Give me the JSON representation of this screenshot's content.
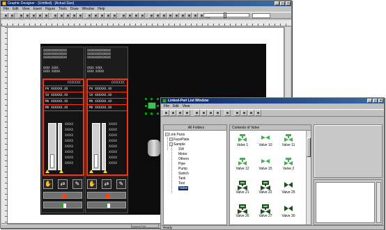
{
  "main_window": {
    "title": "Graphic Designer - [Untitled] - [Actual Size]",
    "menu": [
      "File",
      "Edit",
      "View",
      "Insert",
      "Figure",
      "Tools",
      "Draw",
      "Window",
      "Help"
    ],
    "status_cell": "Linked-Part"
  },
  "faceplates": [
    {
      "header_lines": [
        "XXXXXXXXXXXXXXXX",
        "XXXXXXXXXXXXXXXX",
        "XXXXXXXXXXXXXXXX"
      ],
      "mid_lines": [
        "XXXX   XXXX",
        "XXXX   XXXXX"
      ],
      "rows": [
        "CCCCCCC",
        "PV  XXXXXX.XX",
        "SV  XXXXXX.XX",
        "MV  XXXXXX.XX",
        "MV  XXXXXX.XX"
      ],
      "scale": [
        "XXXXX",
        "XXXXX",
        "XXXXX",
        "XXXXX",
        "XXXXX",
        "XXXXX",
        "XXXXX",
        "XXXXX"
      ]
    },
    {
      "header_lines": [
        "XXXXXXXXXXXXXXXX",
        "XXXXXXXXXXXXXXXX",
        "XXXXXXXXXXXXXXXX"
      ],
      "mid_lines": [
        "XXXX   XXXX",
        "XXXX   XXXXX"
      ],
      "rows": [
        "CCCCCCC",
        "PV  XXXXXX.XX",
        "SV  XXXXXX.XX",
        "MV  XXXXXX.XX",
        "MV  XXXXXX.XX"
      ],
      "scale": [
        "XXXXX",
        "XXXXX",
        "XXXXX",
        "XXXXX",
        "XXXXX",
        "XXXXX",
        "XXXXX",
        "XXXXX"
      ]
    }
  ],
  "linked_part_window": {
    "title": "Linked-Part List Window",
    "menu": [
      "File",
      "Edit",
      "View"
    ],
    "tree_header": "All Folders",
    "gallery_header": "Contents of Valve",
    "tree": {
      "root": "Link Parts",
      "faceplate": "FacePlate",
      "sample": "Sample",
      "sample_children": [
        "SW",
        "Motor",
        "Others",
        "Pipe",
        "Pump",
        "Switch",
        "Tank",
        "Tool",
        "Valve"
      ]
    },
    "items": [
      {
        "label": "Valve 1",
        "icon": "valve-green"
      },
      {
        "label": "Valve 10",
        "icon": "valve-green-bowtie"
      },
      {
        "label": "Valve 11",
        "icon": "valve-green"
      },
      {
        "label": "Valve 12",
        "icon": "valve-green"
      },
      {
        "label": "Valve 15",
        "icon": "valve-green-bowtie"
      },
      {
        "label": "Valve 2",
        "icon": "valve-green"
      },
      {
        "label": "Valve 21",
        "icon": "valve-actuator"
      },
      {
        "label": "Valve 22",
        "icon": "valve-actuator"
      },
      {
        "label": "Valve 25",
        "icon": "valve-bowtie-dark"
      },
      {
        "label": "Valve 26",
        "icon": "valve-actuator"
      },
      {
        "label": "Valve 27",
        "icon": "valve-actuator"
      },
      {
        "label": "Valve 30",
        "icon": "valve-bowtie-dark"
      }
    ],
    "status": "Ready"
  },
  "colors": {
    "titlebar": "#0a246a",
    "faceplate_border": "#ff3010",
    "valve_green": "#40b050",
    "valve_dark": "#205020",
    "canvas_dark": "#0c0c0c"
  }
}
